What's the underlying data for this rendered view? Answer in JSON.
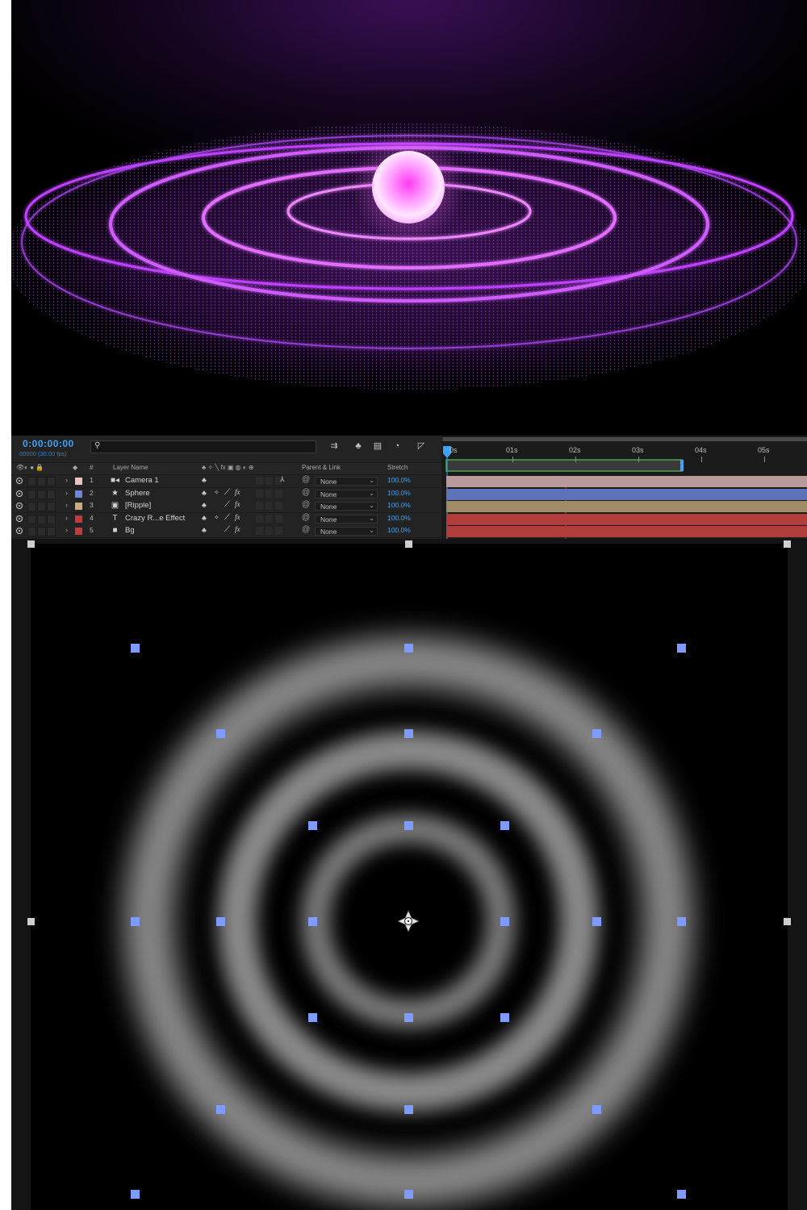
{
  "colors": {
    "timecode": "#3ea3f6",
    "ripple_glow": "#c040ff",
    "handle": "#7f9bff",
    "panel_bg": "#232323"
  },
  "timeline": {
    "timecode": "0:00:00:00",
    "frames": "00000 (30.00 fps)",
    "search_placeholder": "",
    "columns": {
      "number": "#",
      "layer_name": "Layer Name",
      "parent_link": "Parent & Link",
      "stretch": "Stretch"
    },
    "ruler_ticks": [
      "0s",
      "01s",
      "02s",
      "03s",
      "04s",
      "05s"
    ],
    "layers": [
      {
        "num": "1",
        "icon": "camera-icon",
        "icon_glyph": "■◂",
        "name": "Camera 1",
        "color": "#e9c3c3",
        "parent": "None",
        "stretch": "100.0%",
        "bar_color": "#b89a9a"
      },
      {
        "num": "2",
        "icon": "star-icon",
        "icon_glyph": "★",
        "name": "Sphere",
        "color": "#6f86d8",
        "parent": "None",
        "stretch": "100.0%",
        "bar_color": "#5e73b7"
      },
      {
        "num": "3",
        "icon": "composition-icon",
        "icon_glyph": "▣",
        "name": "[Ripple]",
        "color": "#c7ac7d",
        "parent": "None",
        "stretch": "100.0%",
        "bar_color": "#a08d68"
      },
      {
        "num": "4",
        "icon": "text-icon",
        "icon_glyph": "T",
        "name": "Crazy R...e Effect",
        "color": "#c23a3a",
        "parent": "None",
        "stretch": "100.0%",
        "bar_color": "#b13c3c"
      },
      {
        "num": "5",
        "icon": "solid-icon",
        "icon_glyph": "■",
        "name": "Bg",
        "color": "#c23a3a",
        "parent": "None",
        "stretch": "100.0%",
        "bar_color": "#b13c3c"
      }
    ]
  }
}
